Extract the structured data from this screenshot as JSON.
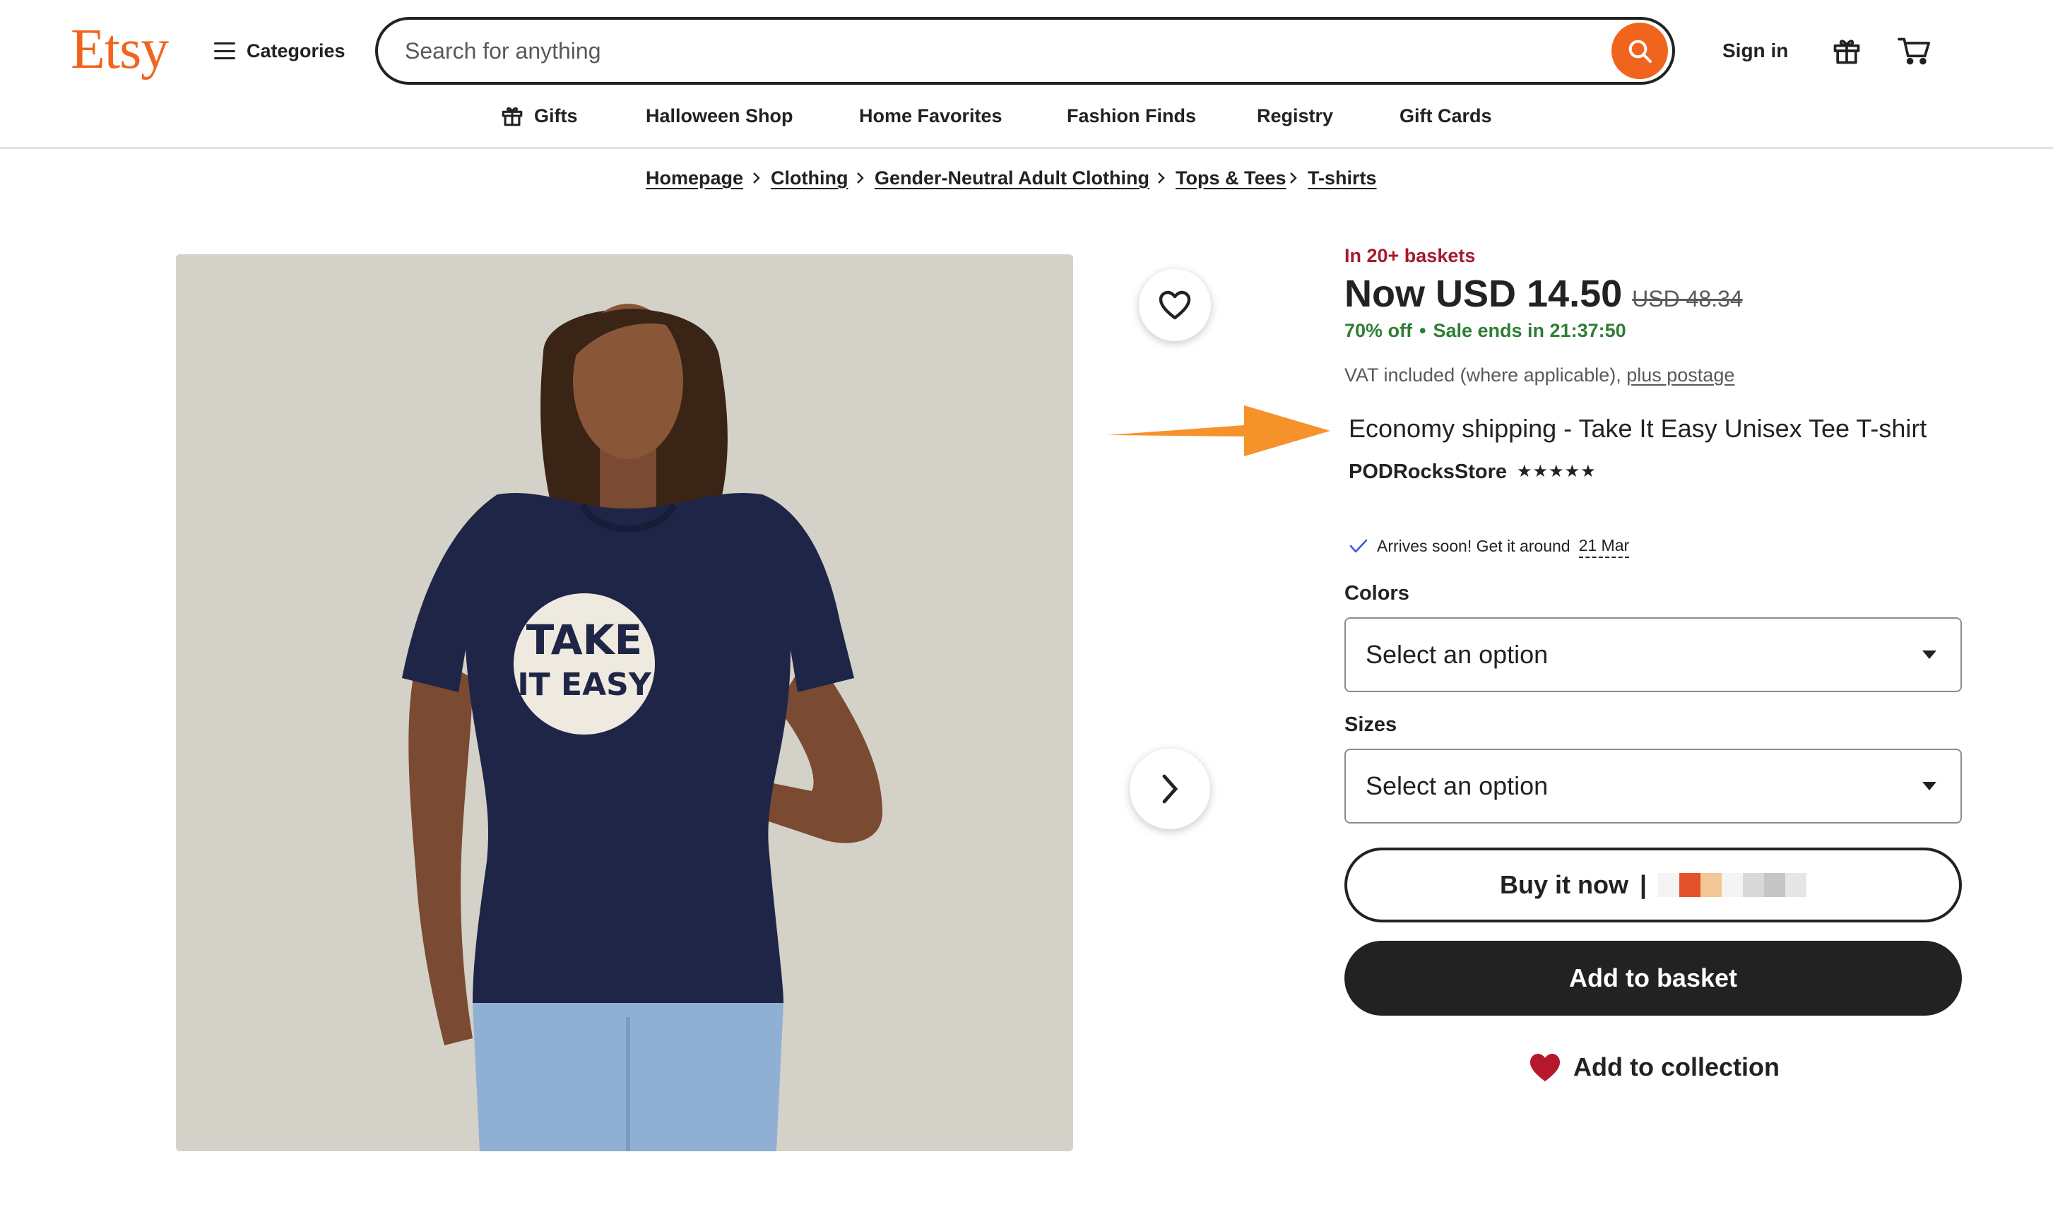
{
  "header": {
    "logo": "Etsy",
    "categories_label": "Categories",
    "search_placeholder": "Search for anything",
    "signin_label": "Sign in"
  },
  "subnav": {
    "items": [
      "Gifts",
      "Halloween Shop",
      "Home Favorites",
      "Fashion Finds",
      "Registry",
      "Gift Cards"
    ]
  },
  "breadcrumb": [
    "Homepage",
    "Clothing",
    "Gender-Neutral Adult Clothing",
    "Tops & Tees",
    "T-shirts"
  ],
  "product": {
    "image_text": "TAKE IT EASY",
    "baskets": "In 20+ baskets",
    "price_now": "Now USD 14.50",
    "price_old": "USD 48.34",
    "discount": "70% off",
    "sale_ends": "Sale ends in 21:37:50",
    "vat_text": "VAT included (where applicable),",
    "postage_link": "plus postage",
    "title": "Economy shipping - Take It Easy Unisex Tee T-shirt",
    "shop_name": "PODRocksStore",
    "rating_stars": "★★★★★",
    "arrives_text": "Arrives soon! Get it around",
    "arrives_date": "21 Mar"
  },
  "options": {
    "colors_label": "Colors",
    "colors_value": "Select an option",
    "sizes_label": "Sizes",
    "sizes_value": "Select an option"
  },
  "actions": {
    "buy_now": "Buy it now",
    "buy_now_separator": "|",
    "add_to_basket": "Add to basket",
    "add_to_collection": "Add to collection"
  },
  "colors": {
    "brand": "#f1641e",
    "baskets": "#a61a2e",
    "sale": "#2f7e35",
    "annotation_arrow": "#f5922a",
    "collection_heart": "#b5172b",
    "shirt": "#1f2546",
    "image_bg": "#d4d1c8"
  },
  "icons": {
    "search": "search-icon",
    "gift": "gift-icon",
    "cart": "cart-icon",
    "favorite": "heart-outline-icon",
    "next": "chevron-right-icon",
    "check": "check-icon",
    "collection": "heart-filled-icon"
  }
}
